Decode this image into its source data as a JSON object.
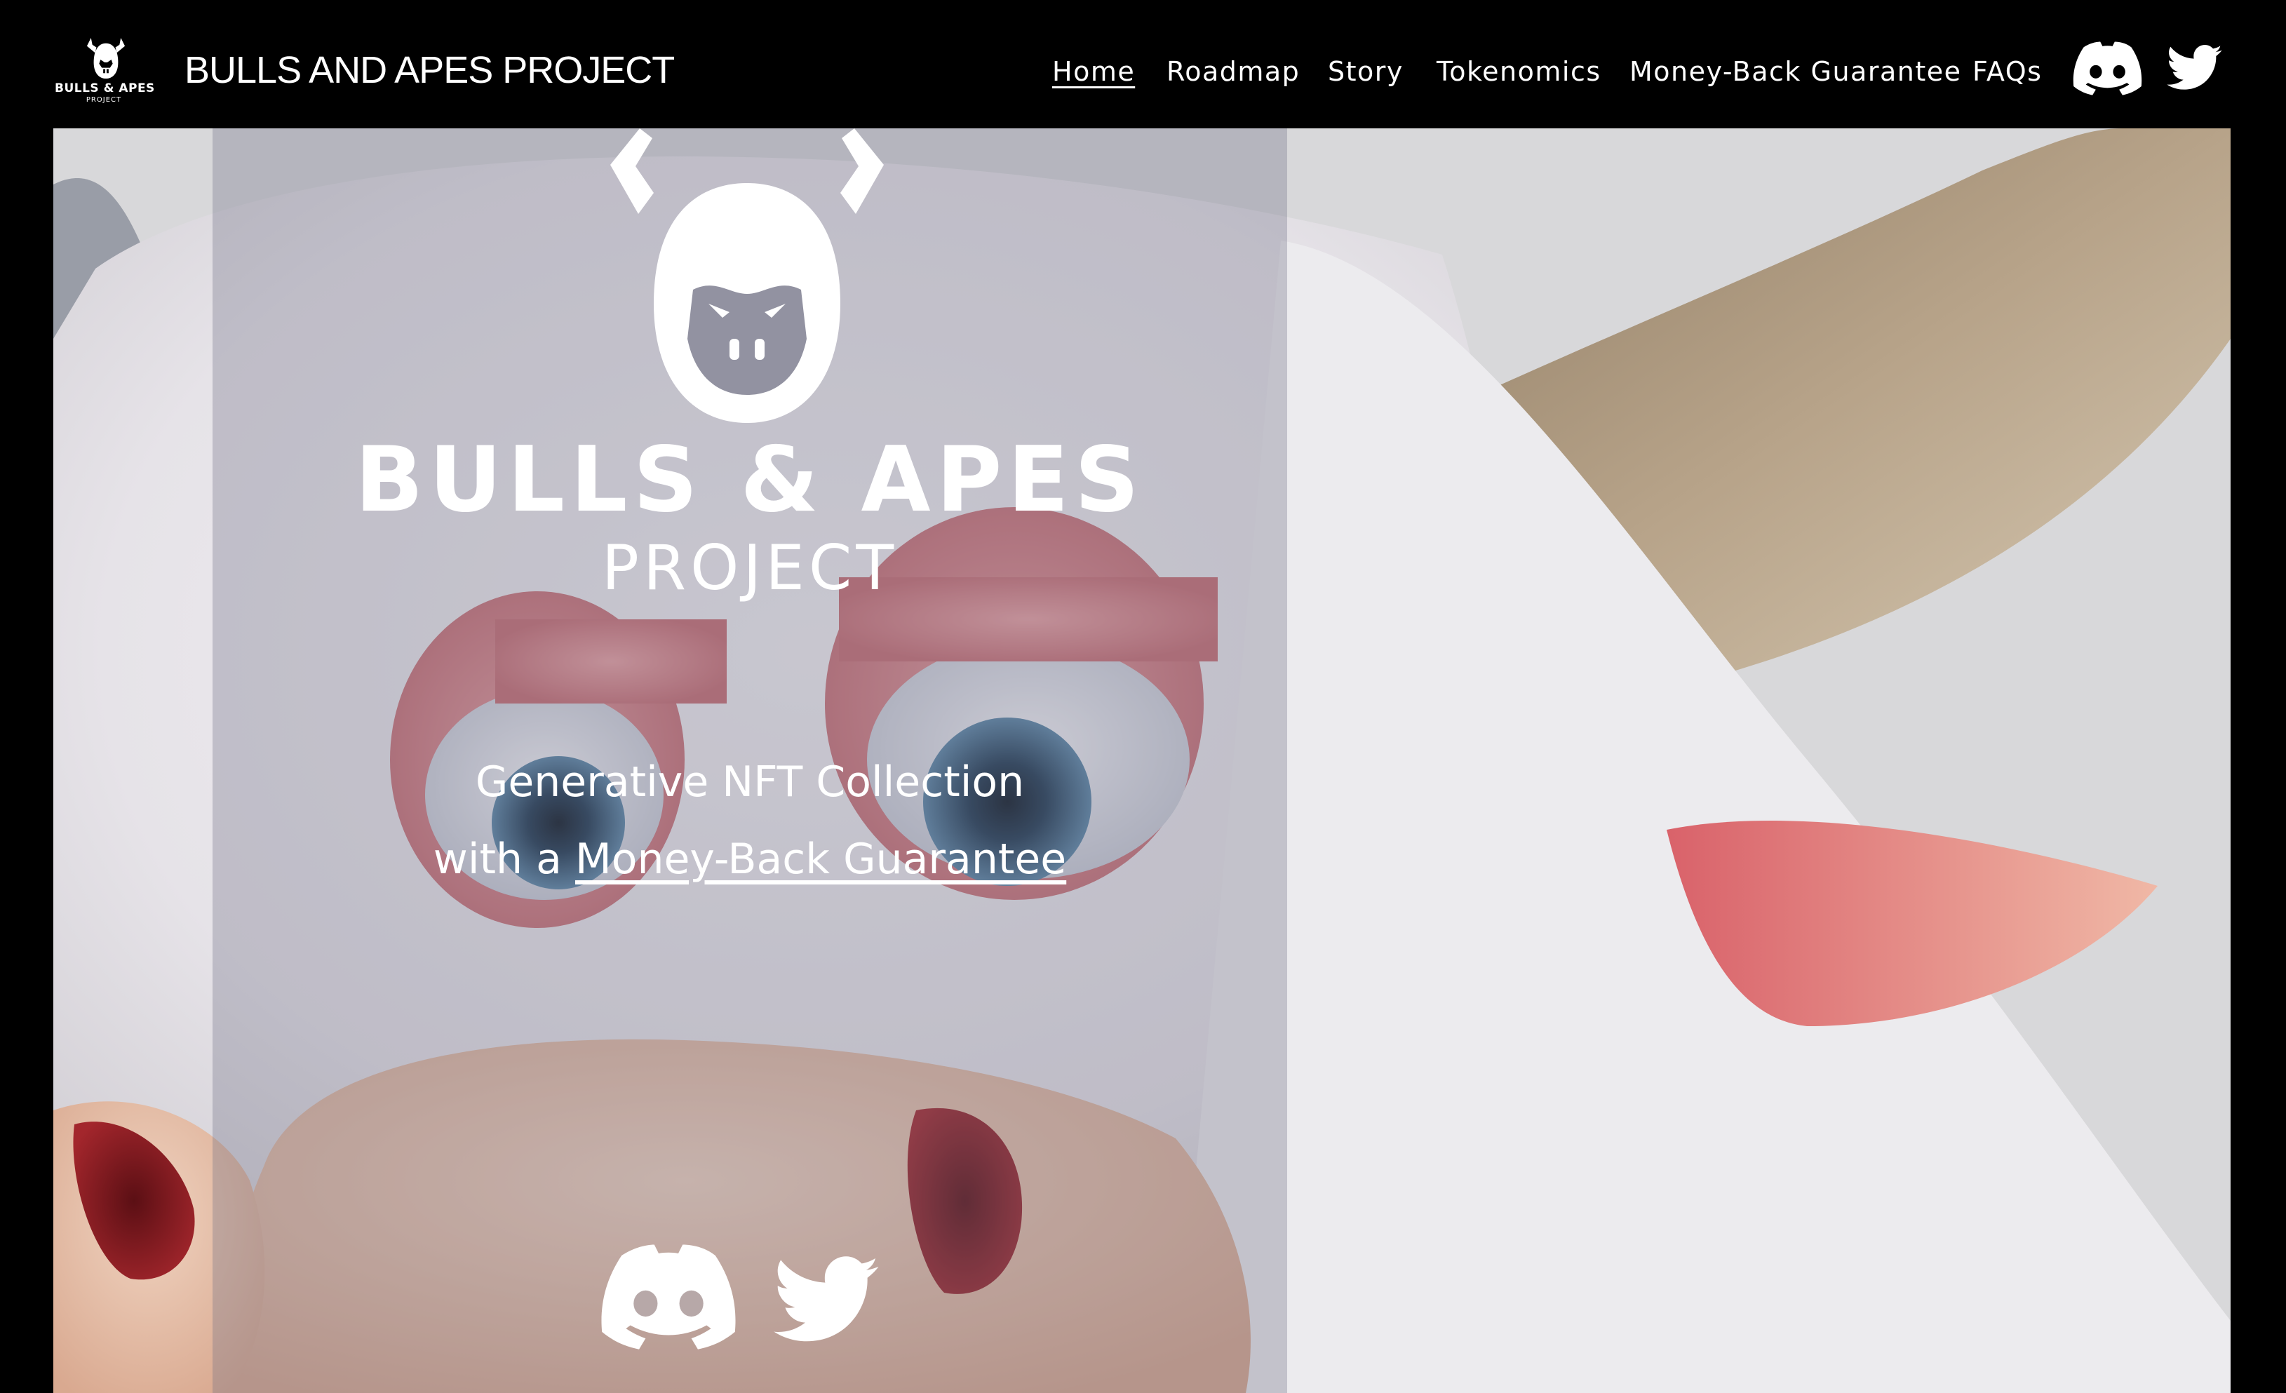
{
  "header": {
    "logo": {
      "line1": "BULLS & APES",
      "line2": "PROJECT",
      "icon": "bull-ape-logo-icon"
    },
    "site_title": "BULLS AND APES PROJECT",
    "nav": [
      {
        "label": "Home",
        "active": true
      },
      {
        "label": "Roadmap",
        "active": false
      },
      {
        "label": "Story",
        "active": false
      },
      {
        "label": "Tokenomics",
        "active": false
      },
      {
        "label": "Money-Back Guarantee",
        "active": false
      },
      {
        "label": "FAQs",
        "active": false
      }
    ],
    "social": [
      {
        "icon": "discord-icon"
      },
      {
        "icon": "twitter-icon"
      }
    ]
  },
  "hero": {
    "brand_line1": "BULLS & APES",
    "brand_line2": "PROJECT",
    "tagline_line1": "Generative NFT Collection",
    "tagline_prefix": "with a",
    "tagline_link": "Money-Back Guarantee",
    "social": [
      {
        "icon": "discord-icon"
      },
      {
        "icon": "twitter-icon"
      }
    ]
  },
  "colors": {
    "header_bg": "#000000",
    "text": "#ffffff",
    "overlay": "rgba(110,110,130,0.32)",
    "fur": "#e9e6ea",
    "horn": "#a89479",
    "eyelid": "#d98a8e",
    "iris": "#4f7390",
    "snout": "#e8c3ae",
    "nostril": "#7e1c22"
  }
}
